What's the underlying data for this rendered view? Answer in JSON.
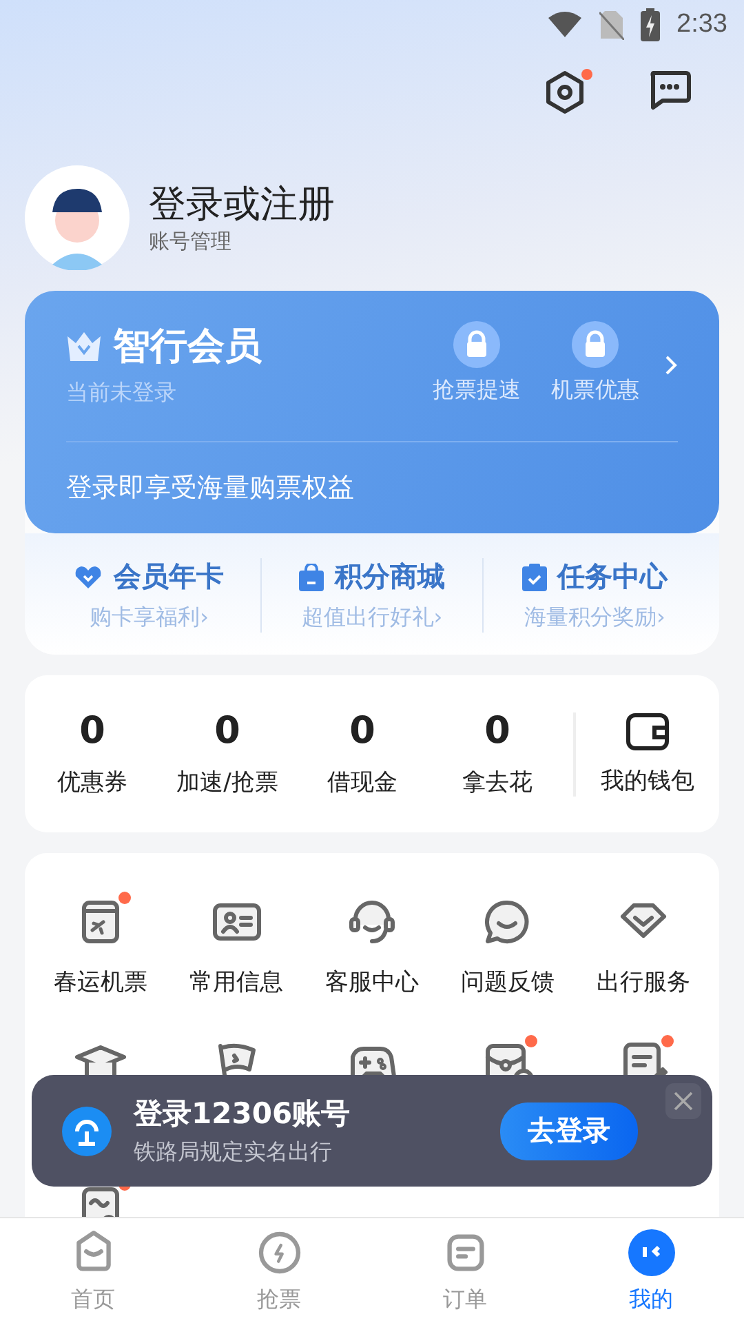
{
  "status_bar": {
    "time": "2:33"
  },
  "header": {
    "settings_badge": true
  },
  "profile": {
    "name": "登录或注册",
    "subtitle": "账号管理"
  },
  "member_card": {
    "title": "智行会员",
    "status": "当前未登录",
    "perks": [
      {
        "label": "抢票提速",
        "locked": true
      },
      {
        "label": "机票优惠",
        "locked": true
      }
    ],
    "promo": "登录即享受海量购票权益"
  },
  "shortcuts": [
    {
      "title": "会员年卡",
      "subtitle": "购卡享福利›"
    },
    {
      "title": "积分商城",
      "subtitle": "超值出行好礼›"
    },
    {
      "title": "任务中心",
      "subtitle": "海量积分奖励›"
    }
  ],
  "wallet": {
    "stats": [
      {
        "value": "0",
        "label": "优惠券"
      },
      {
        "value": "0",
        "label": "加速/抢票"
      },
      {
        "value": "0",
        "label": "借现金"
      },
      {
        "value": "0",
        "label": "拿去花"
      }
    ],
    "label": "我的钱包"
  },
  "services": [
    {
      "label": "春运机票",
      "badge": true
    },
    {
      "label": "常用信息",
      "badge": false
    },
    {
      "label": "客服中心",
      "badge": false
    },
    {
      "label": "问题反馈",
      "badge": false
    },
    {
      "label": "出行服务",
      "badge": false
    },
    {
      "badge": false
    },
    {
      "badge": false
    },
    {
      "badge": false
    },
    {
      "badge": true
    },
    {
      "badge": true
    },
    {
      "badge": true
    }
  ],
  "login_banner": {
    "title": "登录12306账号",
    "subtitle": "铁路局规定实名出行",
    "button": "去登录"
  },
  "tabs": [
    {
      "label": "首页",
      "selected": false
    },
    {
      "label": "抢票",
      "selected": false
    },
    {
      "label": "订单",
      "selected": false
    },
    {
      "label": "我的",
      "selected": true
    }
  ]
}
